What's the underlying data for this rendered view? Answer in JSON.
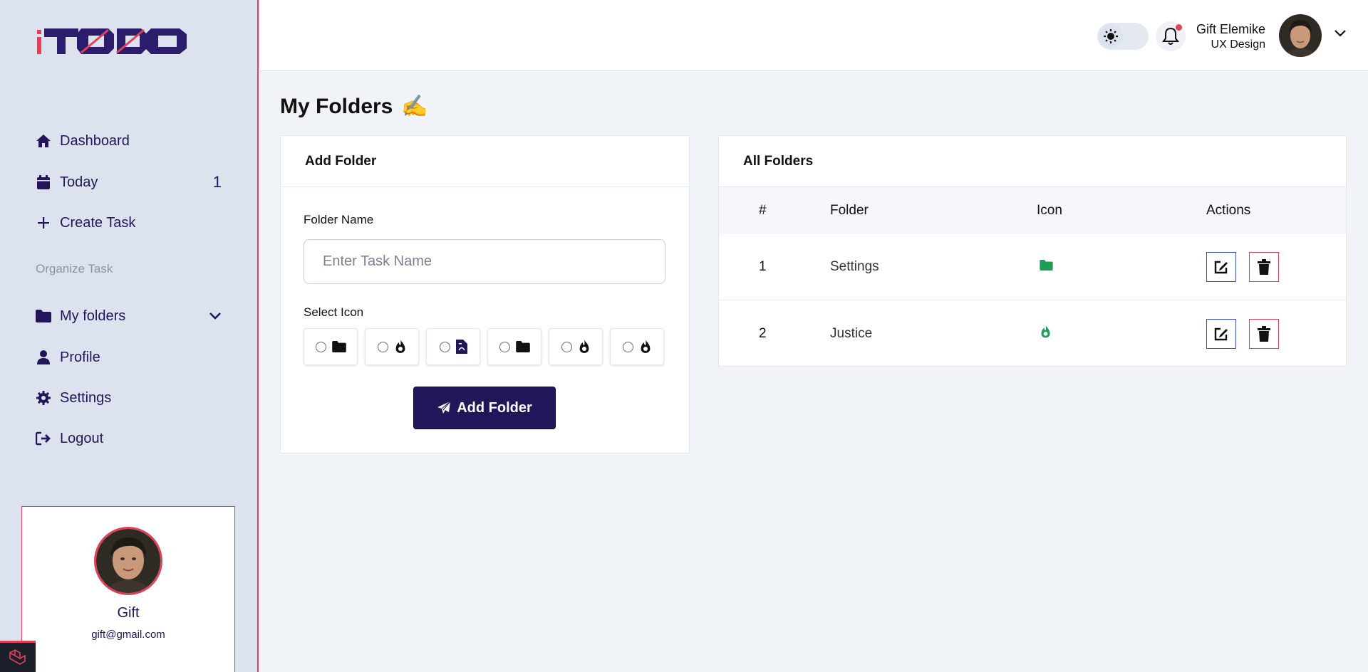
{
  "app": {
    "logo_text": "iTODO"
  },
  "sidebar": {
    "items": [
      {
        "label": "Dashboard",
        "icon": "home-icon"
      },
      {
        "label": "Today",
        "icon": "calendar-icon",
        "count": "1"
      },
      {
        "label": "Create Task",
        "icon": "plus-icon"
      },
      {
        "label": "My folders",
        "icon": "folder-icon"
      },
      {
        "label": "Profile",
        "icon": "user-icon"
      },
      {
        "label": "Settings",
        "icon": "gear-icon"
      },
      {
        "label": "Logout",
        "icon": "logout-icon"
      }
    ],
    "section_label": "Organize Task",
    "profile": {
      "name": "Gift",
      "email": "gift@gmail.com"
    }
  },
  "header": {
    "user_name": "Gift Elemike",
    "user_role": "UX Design"
  },
  "page": {
    "title": "My Folders",
    "title_emoji": "✍️"
  },
  "add_folder": {
    "title": "Add Folder",
    "name_label": "Folder Name",
    "name_placeholder": "Enter Task Name",
    "icon_label": "Select Icon",
    "icon_options": [
      "folder-icon",
      "fire-icon",
      "file-pdf-icon",
      "folder-icon",
      "fire-icon",
      "fire-icon"
    ],
    "submit_label": "Add Folder"
  },
  "all_folders": {
    "title": "All Folders",
    "columns": [
      "#",
      "Folder",
      "Icon",
      "Actions"
    ],
    "rows": [
      {
        "num": "1",
        "folder": "Settings",
        "icon": "folder-icon"
      },
      {
        "num": "2",
        "folder": "Justice",
        "icon": "fire-icon"
      }
    ]
  },
  "colors": {
    "brand": "#221559",
    "accent": "#e0405a",
    "success": "#1f9d55",
    "edit_border": "#3c4fc9"
  }
}
